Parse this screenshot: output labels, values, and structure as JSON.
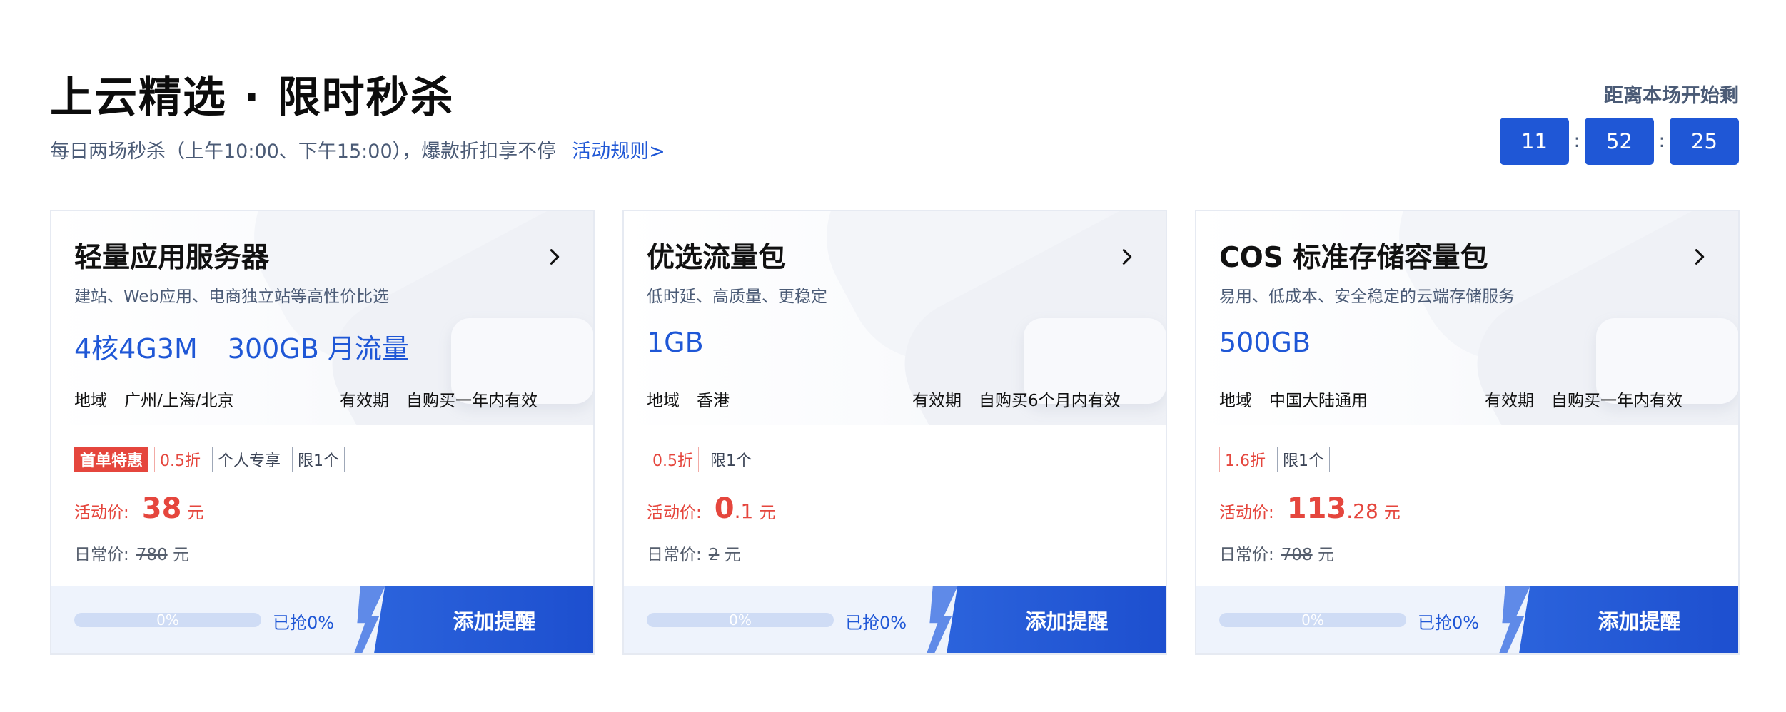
{
  "header": {
    "title": "上云精选 · 限时秒杀",
    "subtitle": "每日两场秒杀（上午10:00、下午15:00），爆款折扣享不停",
    "rules_link": "活动规则>",
    "countdown_label": "距离本场开始剩",
    "countdown": {
      "hours": "11",
      "minutes": "52",
      "seconds": "25",
      "separator": ":"
    }
  },
  "cards": [
    {
      "title": "轻量应用服务器",
      "desc": "建站、Web应用、电商独立站等高性价比选",
      "spec_main": "4核4G3M",
      "spec_extra": "300GB 月流量",
      "region_label": "地域",
      "region": "广州/上海/北京",
      "validity_label": "有效期",
      "validity": "自购买一年内有效",
      "tags": [
        {
          "text": "首单特惠",
          "style": "solid"
        },
        {
          "text": "0.5折",
          "style": "red"
        },
        {
          "text": "个人专享",
          "style": "plain"
        },
        {
          "text": "限1个",
          "style": "plain"
        }
      ],
      "price_label": "活动价:",
      "price_int": "38",
      "price_dec": "",
      "price_unit": "元",
      "orig_label": "日常价:",
      "orig_value": "780",
      "orig_unit": "元",
      "progress": 0,
      "progress_text": "0%",
      "grabbed": "已抢0%",
      "cta": "添加提醒"
    },
    {
      "title": "优选流量包",
      "desc": "低时延、高质量、更稳定",
      "spec_main": "1GB",
      "spec_extra": "",
      "region_label": "地域",
      "region": "香港",
      "validity_label": "有效期",
      "validity": "自购买6个月内有效",
      "tags": [
        {
          "text": "0.5折",
          "style": "red"
        },
        {
          "text": "限1个",
          "style": "plain"
        }
      ],
      "price_label": "活动价:",
      "price_int": "0",
      "price_dec": ".1",
      "price_unit": "元",
      "orig_label": "日常价:",
      "orig_value": "2",
      "orig_unit": "元",
      "progress": 0,
      "progress_text": "0%",
      "grabbed": "已抢0%",
      "cta": "添加提醒"
    },
    {
      "title": "COS 标准存储容量包",
      "desc": "易用、低成本、安全稳定的云端存储服务",
      "spec_main": "500GB",
      "spec_extra": "",
      "region_label": "地域",
      "region": "中国大陆通用",
      "validity_label": "有效期",
      "validity": "自购买一年内有效",
      "tags": [
        {
          "text": "1.6折",
          "style": "red"
        },
        {
          "text": "限1个",
          "style": "plain"
        }
      ],
      "price_label": "活动价:",
      "price_int": "113",
      "price_dec": ".28",
      "price_unit": "元",
      "orig_label": "日常价:",
      "orig_value": "708",
      "orig_unit": "元",
      "progress": 0,
      "progress_text": "0%",
      "grabbed": "已抢0%",
      "cta": "添加提醒"
    }
  ],
  "colors": {
    "accent": "#1f57d6",
    "price": "#e5463d",
    "muted": "#4b5b76"
  },
  "icons": {
    "card_arrow": "chevron-right-icon",
    "cta_decoration": "lightning-icon"
  }
}
